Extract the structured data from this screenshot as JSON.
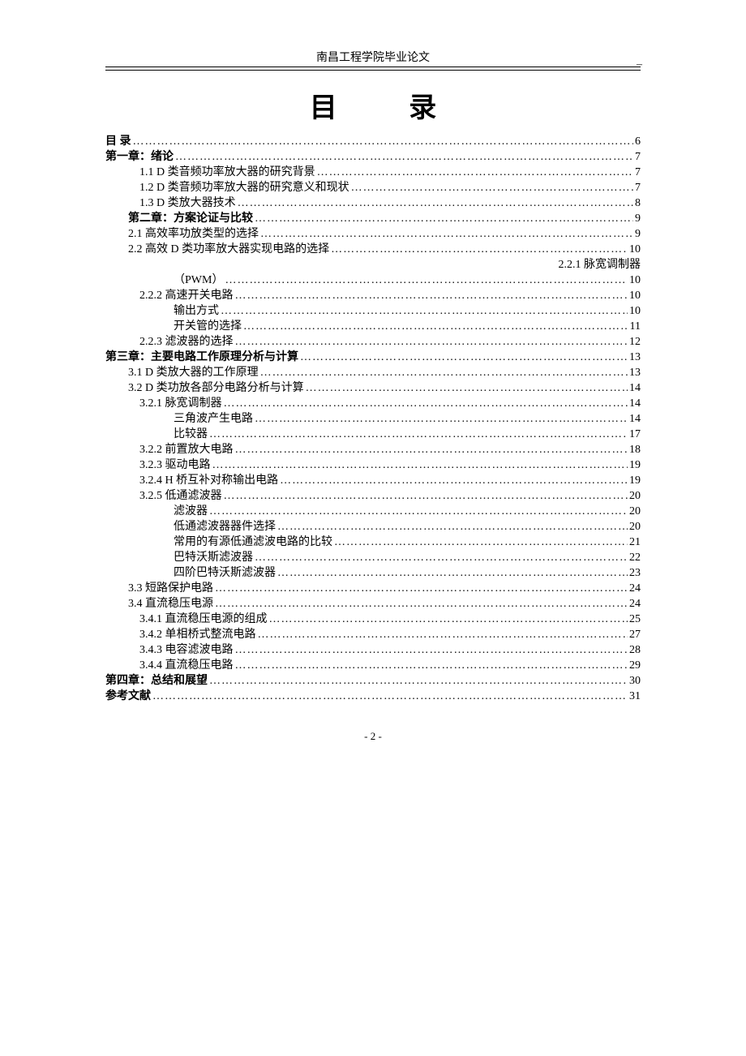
{
  "header": {
    "text": "南昌工程学院毕业论文",
    "dash": "–"
  },
  "title": "目 录",
  "pwm_right": "2.2.1 脉宽调制器",
  "toc": [
    {
      "label": "目    录",
      "page": "6",
      "indent": 1,
      "bold": true
    },
    {
      "label": "第一章：绪论",
      "page": "7",
      "indent": 1,
      "bold": true
    },
    {
      "label": "1.1 D 类音频功率放大器的研究背景",
      "page": "7",
      "indent": 3
    },
    {
      "label": "1.2 D 类音频功率放大器的研究意义和现状",
      "page": "7",
      "indent": 3
    },
    {
      "label": "1.3 D 类放大器技术",
      "page": "8",
      "indent": 3
    },
    {
      "label": "第二章：方案论证与比较",
      "page": "9",
      "indent": 2,
      "bold": true
    },
    {
      "label": "2.1 高效率功放类型的选择",
      "page": "9",
      "indent": 2
    },
    {
      "label": "2.2 高效 D 类功率放大器实现电路的选择",
      "page": "10",
      "indent": 2
    },
    {
      "label": "（PWM）",
      "page": "10",
      "indent": 4,
      "special": "pwm"
    },
    {
      "label": "2.2.2 高速开关电路",
      "page": "10",
      "indent": 3
    },
    {
      "label": "输出方式",
      "page": "10",
      "indent": 4
    },
    {
      "label": "开关管的选择",
      "page": "11",
      "indent": 4
    },
    {
      "label": "2.2.3 滤波器的选择",
      "page": "12",
      "indent": 3
    },
    {
      "label": "第三章：主要电路工作原理分析与计算",
      "page": "13",
      "indent": 1,
      "bold": true
    },
    {
      "label": "3.1   D 类放大器的工作原理",
      "page": "13",
      "indent": 2
    },
    {
      "label": "3.2   D 类功放各部分电路分析与计算",
      "page": "14",
      "indent": 2
    },
    {
      "label": "3.2.1  脉宽调制器",
      "page": "14",
      "indent": 3
    },
    {
      "label": "三角波产生电路",
      "page": "14",
      "indent": 4
    },
    {
      "label": "比较器",
      "page": "17",
      "indent": 4
    },
    {
      "label": "3.2.2  前置放大电路",
      "page": "18",
      "indent": 3
    },
    {
      "label": "3.2.3  驱动电路",
      "page": "19",
      "indent": 3
    },
    {
      "label": "3.2.4 H 桥互补对称输出电路",
      "page": "19",
      "indent": 3
    },
    {
      "label": "3.2.5  低通滤波器",
      "page": "20",
      "indent": 3
    },
    {
      "label": "滤波器",
      "page": "20",
      "indent": 4
    },
    {
      "label": "低通滤波器器件选择",
      "page": "20",
      "indent": 4
    },
    {
      "label": "常用的有源低通滤波电路的比较",
      "page": "21",
      "indent": 4
    },
    {
      "label": "巴特沃斯滤波器",
      "page": "22",
      "indent": 4
    },
    {
      "label": "四阶巴特沃斯滤波器",
      "page": "23",
      "indent": 4
    },
    {
      "label": "3.3  短路保护电路",
      "page": "24",
      "indent": 2
    },
    {
      "label": "3.4  直流稳压电源",
      "page": "24",
      "indent": 2
    },
    {
      "label": "3.4.1  直流稳压电源的组成",
      "page": "25",
      "indent": 3
    },
    {
      "label": "3.4.2  单相桥式整流电路",
      "page": "27",
      "indent": 3
    },
    {
      "label": "3.4.3  电容滤波电路",
      "page": "28",
      "indent": 3
    },
    {
      "label": "3.4.4  直流稳压电路",
      "page": "29",
      "indent": 3
    },
    {
      "label": "第四章：总结和展望",
      "page": "30",
      "indent": 1,
      "bold": true
    },
    {
      "label": "参考文献",
      "page": "31",
      "indent": 1,
      "bold": true
    }
  ],
  "footer": "- 2 -"
}
